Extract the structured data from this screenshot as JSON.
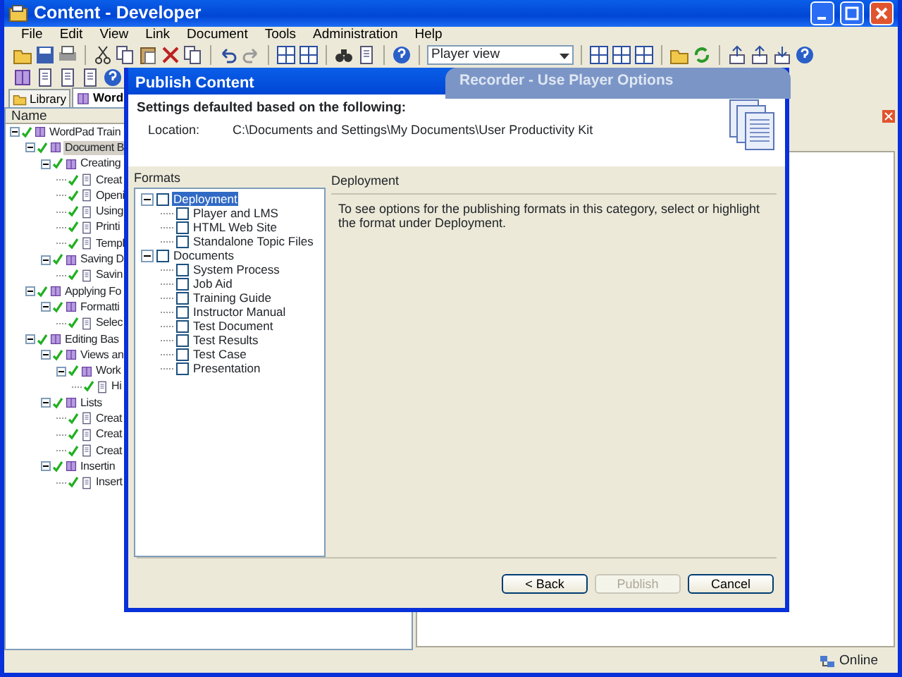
{
  "window": {
    "title": "Content - Developer"
  },
  "menu": [
    "File",
    "Edit",
    "View",
    "Link",
    "Document",
    "Tools",
    "Administration",
    "Help"
  ],
  "toolbar": {
    "view_select": "Player view"
  },
  "tabs": [
    {
      "label": "Library",
      "selected": false
    },
    {
      "label": "Word",
      "selected": true
    }
  ],
  "tree_header": "Name",
  "tree": [
    {
      "label": "WordPad Train",
      "kind": "book",
      "selected": false,
      "children": [
        {
          "label": "Document B",
          "kind": "book",
          "selected": true,
          "children": [
            {
              "label": "Creating",
              "kind": "section",
              "selected": false,
              "children": [
                {
                  "label": "Creat",
                  "kind": "topic",
                  "selected": false
                },
                {
                  "label": "Openi",
                  "kind": "topic",
                  "selected": false
                },
                {
                  "label": "Using",
                  "kind": "topic",
                  "selected": false
                },
                {
                  "label": "Printi",
                  "kind": "topic",
                  "selected": false
                },
                {
                  "label": "Templ",
                  "kind": "page",
                  "selected": false
                }
              ]
            },
            {
              "label": "Saving D",
              "kind": "section",
              "selected": false,
              "children": [
                {
                  "label": "Savin",
                  "kind": "topic",
                  "selected": false
                }
              ]
            }
          ]
        },
        {
          "label": "Applying Fo",
          "kind": "book",
          "selected": false,
          "children": [
            {
              "label": "Formatti",
              "kind": "section",
              "selected": false,
              "children": [
                {
                  "label": "Selec",
                  "kind": "topic",
                  "selected": false
                }
              ]
            }
          ]
        },
        {
          "label": "Editing Bas",
          "kind": "book",
          "selected": false,
          "children": [
            {
              "label": "Views an",
              "kind": "section",
              "selected": false,
              "children": [
                {
                  "label": "Work",
                  "kind": "section",
                  "selected": false,
                  "children": [
                    {
                      "label": "Hi",
                      "kind": "topic",
                      "selected": false
                    }
                  ]
                }
              ]
            },
            {
              "label": "Lists",
              "kind": "section",
              "selected": false,
              "children": [
                {
                  "label": "Creat",
                  "kind": "topic",
                  "selected": false
                },
                {
                  "label": "Creat",
                  "kind": "topic",
                  "selected": false
                },
                {
                  "label": "Creat",
                  "kind": "topic",
                  "selected": false
                }
              ]
            },
            {
              "label": "Insertin",
              "kind": "section",
              "selected": false,
              "children": [
                {
                  "label": "Insert",
                  "kind": "topic",
                  "selected": false
                }
              ]
            }
          ]
        }
      ]
    }
  ],
  "background_window": {
    "title": "Recorder - Use Player Options"
  },
  "dialog": {
    "title": "Publish Content",
    "heading": "Settings defaulted based on the following:",
    "location_label": "Location:",
    "location_value": "C:\\Documents and Settings\\My Documents\\User Productivity Kit",
    "formats_label": "Formats",
    "formats": [
      {
        "label": "Deployment",
        "checked": false,
        "selected": true,
        "children": [
          {
            "label": "Player and LMS",
            "checked": false,
            "selected": false
          },
          {
            "label": "HTML Web Site",
            "checked": false,
            "selected": false
          },
          {
            "label": "Standalone Topic Files",
            "checked": false,
            "selected": false
          }
        ]
      },
      {
        "label": "Documents",
        "checked": false,
        "selected": false,
        "children": [
          {
            "label": "System Process",
            "checked": false,
            "selected": false
          },
          {
            "label": "Job Aid",
            "checked": false,
            "selected": false
          },
          {
            "label": "Training Guide",
            "checked": false,
            "selected": false
          },
          {
            "label": "Instructor Manual",
            "checked": false,
            "selected": false
          },
          {
            "label": "Test Document",
            "checked": false,
            "selected": false
          },
          {
            "label": "Test Results",
            "checked": false,
            "selected": false
          },
          {
            "label": "Test Case",
            "checked": false,
            "selected": false
          },
          {
            "label": "Presentation",
            "checked": false,
            "selected": false
          }
        ]
      }
    ],
    "detail_title": "Deployment",
    "detail_text": "To see options for the publishing formats in this category, select or highlight the format under Deployment.",
    "buttons": [
      {
        "label": "< Back",
        "disabled": false
      },
      {
        "label": "Publish",
        "disabled": true
      },
      {
        "label": "Cancel",
        "disabled": false
      }
    ]
  },
  "status_bar": {
    "text": "Online"
  }
}
